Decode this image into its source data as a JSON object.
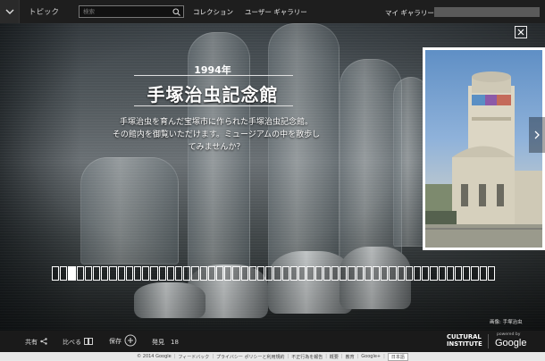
{
  "header": {
    "topics_label": "トピック",
    "search_placeholder": "検索",
    "nav": [
      "コレクション",
      "ユーザー ギャラリー"
    ],
    "my_gallery": "マイ ギャラリー"
  },
  "slide": {
    "year": "1994年",
    "title": "手塚治虫記念館",
    "description_lines": [
      "手塚治虫を育んだ宝塚市に作られた手塚治虫記念館。",
      "その館内を御覧いただけます。ミュージアムの中を散歩し",
      "てみませんか？"
    ],
    "image_credit": "画像: 手塚治虫"
  },
  "timeline": {
    "thumb_count": 54,
    "active_index": 2
  },
  "toolbar": {
    "share": "共有",
    "compare": "比べる",
    "save": "保存",
    "discover": "発見",
    "discover_count": "18"
  },
  "branding": {
    "ci_line1": "CULTURAL",
    "ci_line2": "INSTITUTE",
    "powered_by": "powered by",
    "google": "Google"
  },
  "footer": {
    "items": [
      "© 2014 Google",
      "フィードバック",
      "プライバシー ポリシーと利用規約",
      "不正行為を報告",
      "概要",
      "教育",
      "Google+"
    ],
    "language": "日本語"
  },
  "icons": {
    "chevron": "chevron-down-icon",
    "search": "search-icon",
    "close": "close-icon",
    "share": "share-icon",
    "compare": "compare-icon",
    "save": "add-circle-icon",
    "next": "chevron-right-icon"
  }
}
